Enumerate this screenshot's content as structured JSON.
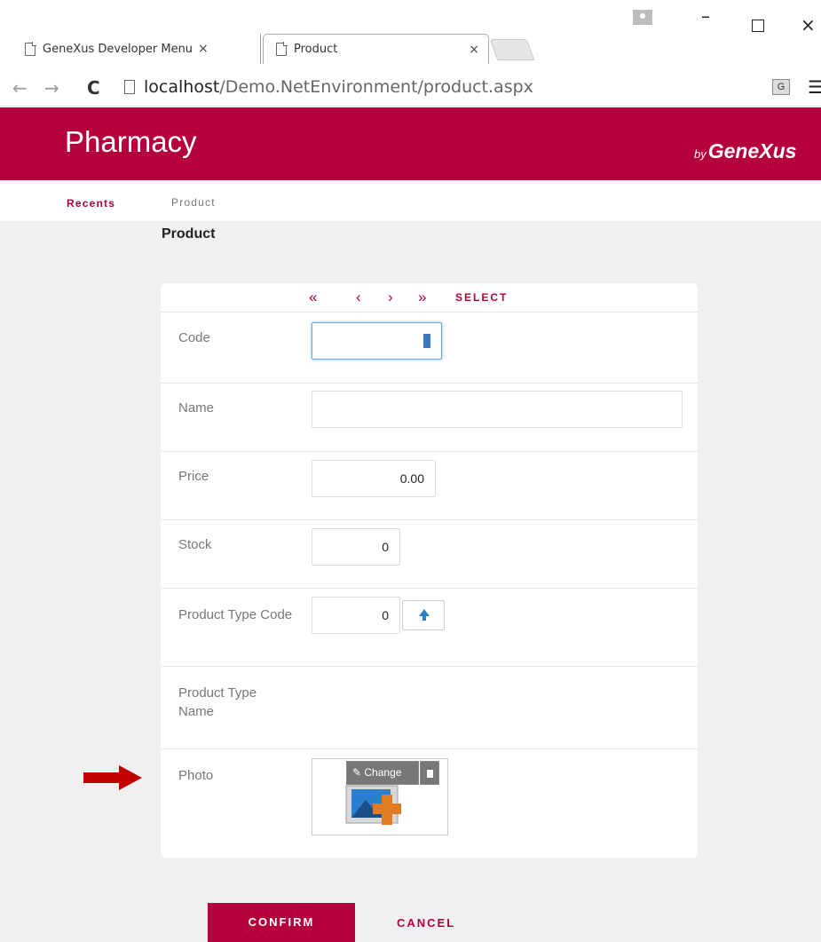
{
  "browser": {
    "tabs": [
      {
        "label": "GeneXus Developer Menu",
        "close": "×"
      },
      {
        "label": "Product",
        "close": "×"
      }
    ],
    "url_host": "localhost",
    "url_path": "/Demo.NetEnvironment/product.aspx",
    "window_controls": {
      "minimize": "–",
      "close": "×"
    }
  },
  "header": {
    "app_title": "Pharmacy",
    "brand_prefix": "by",
    "brand_name": "GeneXus",
    "brand_color": "#b5003e"
  },
  "breadcrumb": {
    "recents": "Recents",
    "current": "Product"
  },
  "page": {
    "title": "Product"
  },
  "navigation": {
    "first": "«",
    "previous": "‹",
    "next": "›",
    "last": "»",
    "select": "SELECT"
  },
  "form": {
    "code": {
      "label": "Code",
      "value": ""
    },
    "name": {
      "label": "Name",
      "value": ""
    },
    "price": {
      "label": "Price",
      "value": "0.00"
    },
    "stock": {
      "label": "Stock",
      "value": "0"
    },
    "product_type_code": {
      "label": "Product Type Code",
      "value": "0"
    },
    "product_type_name": {
      "label": "Product Type Name"
    },
    "photo": {
      "label": "Photo",
      "change_label": "Change"
    }
  },
  "actions": {
    "confirm": "CONFIRM",
    "cancel": "CANCEL"
  },
  "icons": {
    "prompt": "up-arrow-icon",
    "change": "pencil-icon",
    "delete": "trash-icon",
    "annotation": "red-arrow-icon"
  }
}
